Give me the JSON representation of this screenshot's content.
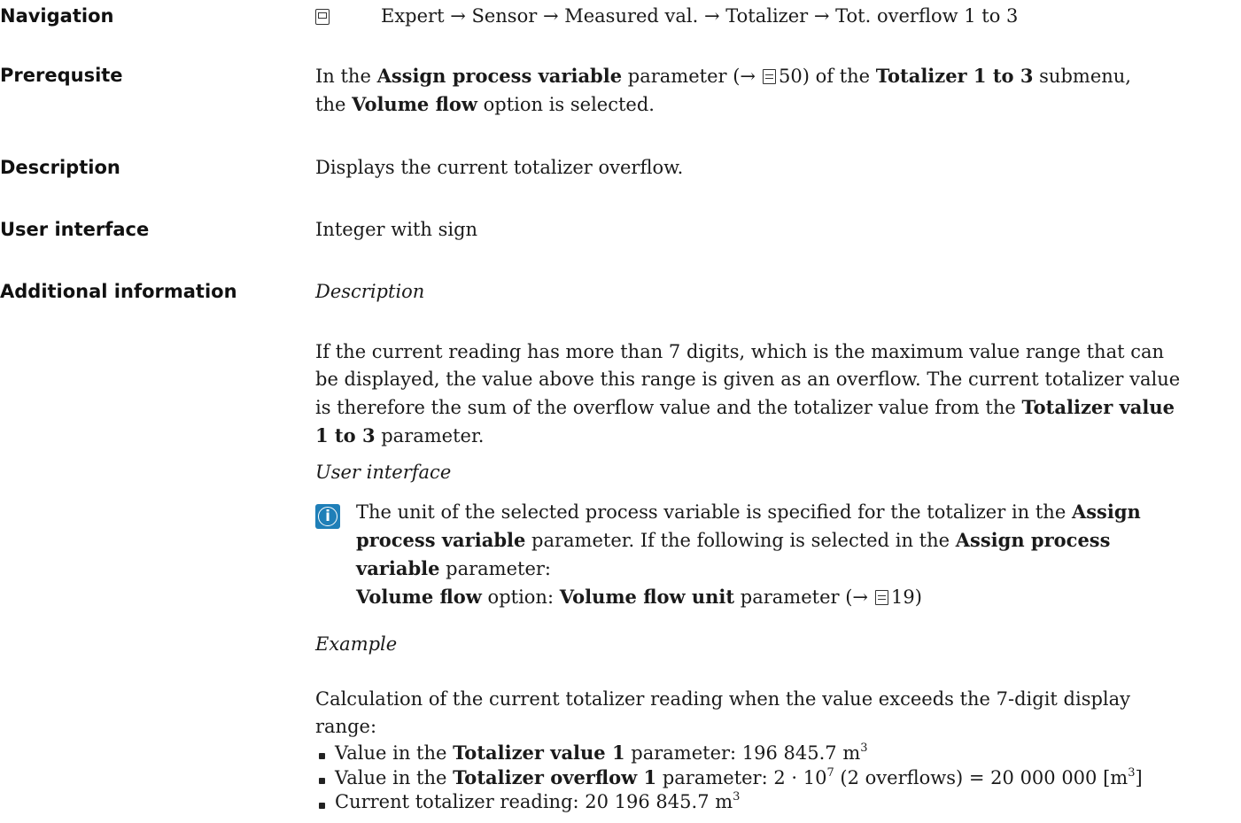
{
  "navigation": {
    "label": "Navigation",
    "path": "Expert → Sensor → Measured val. → Totalizer → Tot. overflow 1 to 3"
  },
  "prerequisite": {
    "label": "Prerequsite",
    "t1": "In the ",
    "b1": "Assign process variable",
    "t2": " parameter (→",
    "ref": "50",
    "t3": ") of the ",
    "b2": "Totalizer 1 to 3",
    "t4": " submenu,",
    "t5": "the ",
    "b3": "Volume flow",
    "t6": " option is selected."
  },
  "description": {
    "label": "Description",
    "text": "Displays the current totalizer overflow."
  },
  "user_interface": {
    "label": "User interface",
    "text": "Integer with sign"
  },
  "additional": {
    "label": "Additional information",
    "desc_heading": "Description",
    "para1_a": "If the current reading has more than 7 digits, which is the maximum value range that can",
    "para1_b": "be displayed, the value above this range is given as an overflow. The current totalizer value",
    "para1_c": "is therefore the sum of the overflow value and the totalizer value from the ",
    "para1_bold1": "Totalizer value",
    "para1_bold2": "1 to 3",
    "para1_end": " parameter.",
    "ui_heading": "User interface",
    "info_t1": "The unit of the selected process variable is specified for the totalizer in the ",
    "info_b1": "Assign",
    "info_b2": "process variable",
    "info_t2": " parameter. If the following is selected in the ",
    "info_b3": "Assign process",
    "info_b4": "variable",
    "info_t3": " parameter:",
    "info_b5": "Volume flow",
    "info_t4": " option: ",
    "info_b6": "Volume flow unit",
    "info_t5": " parameter (→",
    "info_ref": "19",
    "example_heading": "Example",
    "example_a": "Calculation of the current totalizer reading when the value exceeds the 7-digit display",
    "example_b": "range:",
    "li1_t": "Value in the ",
    "li1_b": "Totalizer value 1",
    "li1_v": " parameter: 196 845.7 m",
    "li2_t": "Value in the ",
    "li2_b": "Totalizer overflow 1",
    "li2_v": " parameter: 2 · 10",
    "li2_rest": " (2 overflows) = 20 000 000 [m",
    "li3": "Current totalizer reading: 20 196 845.7 m"
  }
}
